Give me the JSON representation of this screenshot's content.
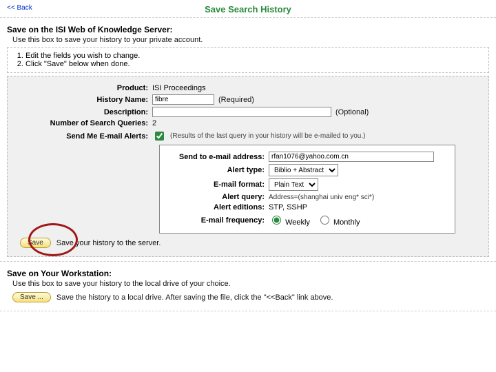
{
  "header": {
    "back": "<< Back",
    "title": "Save Search History"
  },
  "server_section": {
    "heading": "Save on the ISI Web of Knowledge Server:",
    "sub": "Use this box to save your history to your private account.",
    "step1": "Edit the fields you wish to change.",
    "step2": "Click \"Save\" below when done.",
    "labels": {
      "product": "Product:",
      "history_name": "History Name:",
      "description": "Description:",
      "num_queries": "Number of Search Queries:",
      "send_alerts": "Send Me E-mail Alerts:"
    },
    "values": {
      "product": "ISI Proceedings",
      "history_name": "fibre",
      "required": "(Required)",
      "description": "",
      "optional": "(Optional)",
      "num_queries": "2",
      "alerts_hint": "(Results of the last query in your history will be e-mailed to you.)"
    },
    "alert_box": {
      "labels": {
        "send_to": "Send to e-mail address:",
        "alert_type": "Alert type:",
        "email_format": "E-mail format:",
        "alert_query": "Alert query:",
        "alert_editions": "Alert editions:",
        "email_freq": "E-mail frequency:"
      },
      "values": {
        "send_to": "rfan1076@yahoo.com.cn",
        "alert_type": "Biblio + Abstract",
        "email_format": "Plain Text",
        "alert_query": "Address=(shanghai univ eng* sci*)",
        "alert_editions": "STP, SSHP",
        "freq_weekly": "Weekly",
        "freq_monthly": "Monthly"
      }
    },
    "save_button": "Save",
    "save_hint": "Save your history to the server."
  },
  "workstation_section": {
    "heading": "Save on Your Workstation:",
    "sub": "Use this box to save your history to the local drive of your choice.",
    "save_button": "Save ...",
    "save_hint": "Save the history to a local drive. After saving the file, click the \"<<Back\" link above."
  }
}
